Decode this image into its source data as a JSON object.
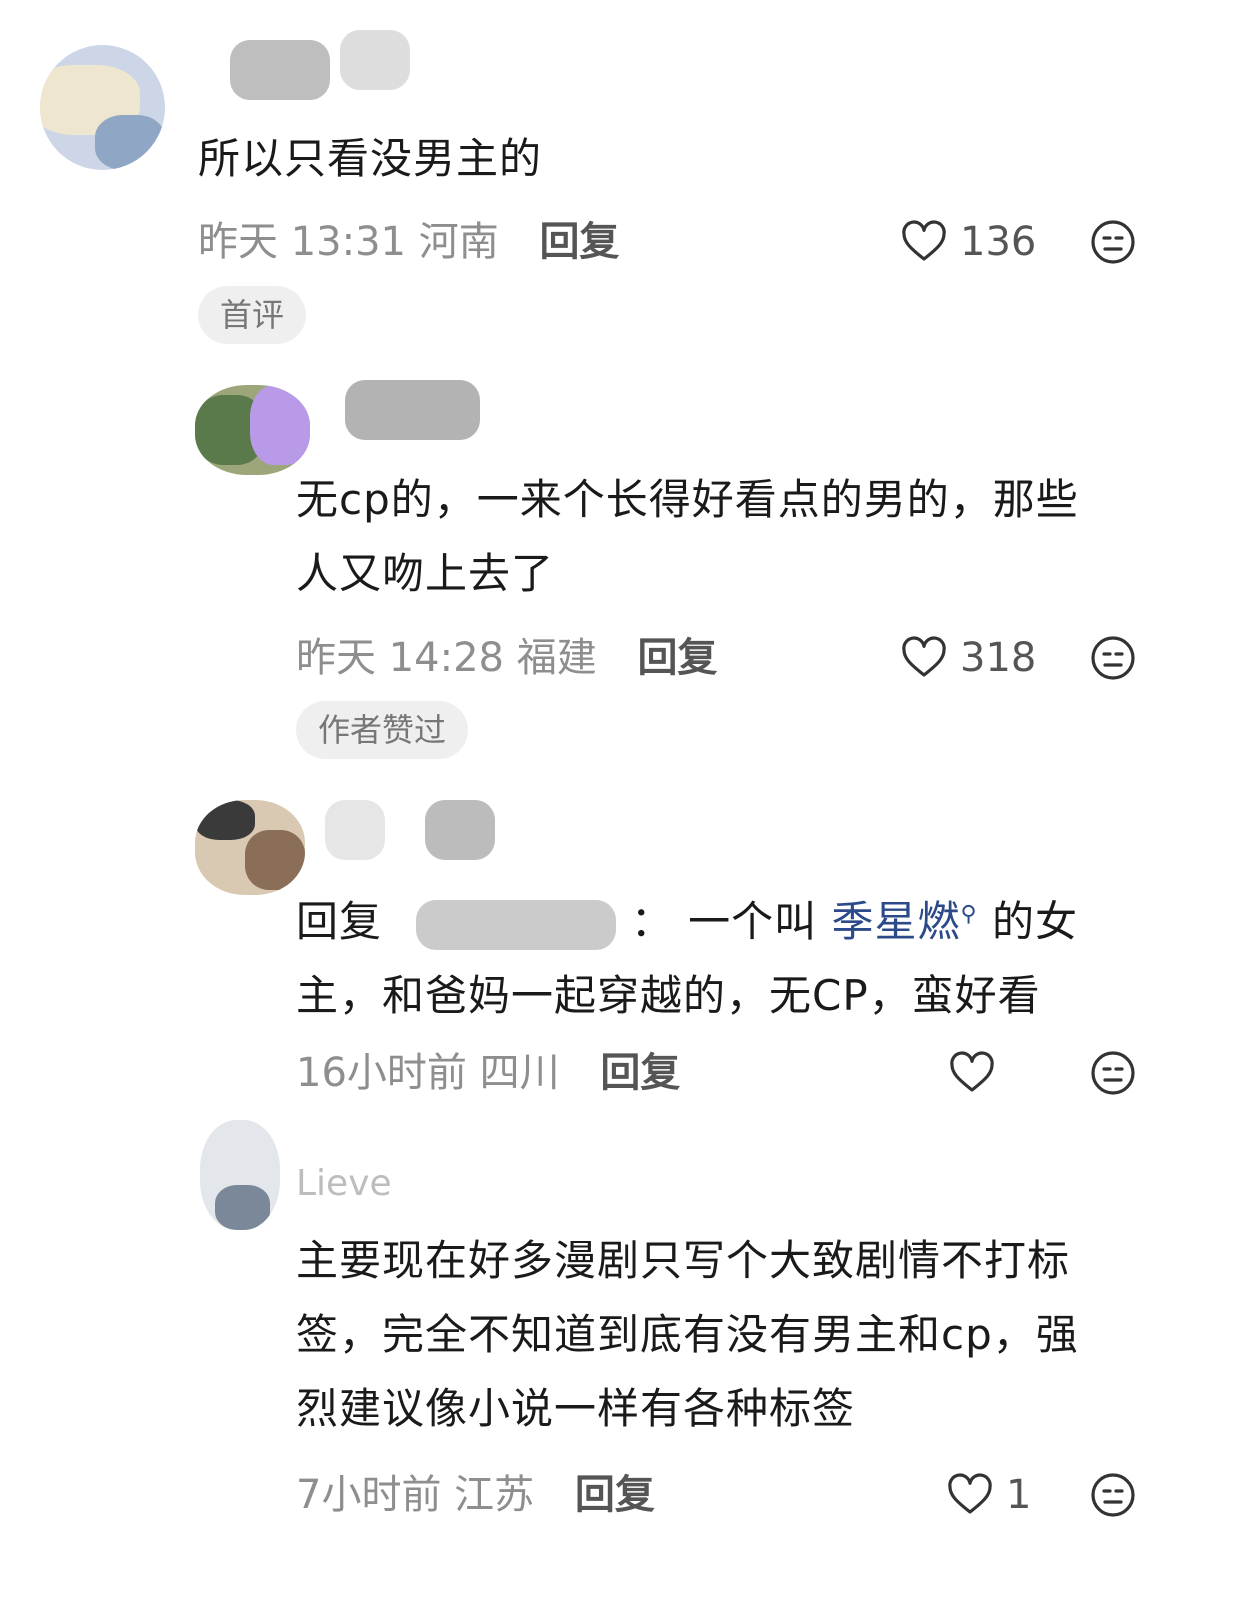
{
  "comments": [
    {
      "text": "所以只看没男主的",
      "time": "昨天 13:31",
      "location": "河南",
      "reply_label": "回复",
      "likes": "136",
      "tag": "首评"
    },
    {
      "text_line1": "无cp的，一来个长得好看点的男的，那些",
      "text_line2": "人又吻上去了",
      "time": "昨天 14:28",
      "location": "福建",
      "reply_label": "回复",
      "likes": "318",
      "tag": "作者赞过"
    },
    {
      "reply_prefix": "回复",
      "colon": "：",
      "text_a": "一个叫",
      "mention": "季星燃",
      "text_b": "的女",
      "text_line2": "主，和爸妈一起穿越的，无CP，蛮好看",
      "time": "16小时前",
      "location": "四川",
      "reply_label": "回复",
      "likes": ""
    },
    {
      "name_partial": "Lieve",
      "text_line1": "主要现在好多漫剧只写个大致剧情不打标",
      "text_line2": "签，完全不知道到底有没有男主和cp，强",
      "text_line3": "烈建议像小说一样有各种标签",
      "time": "7小时前",
      "location": "江苏",
      "reply_label": "回复",
      "likes": "1"
    }
  ],
  "icons": {
    "like": "heart-outline-icon",
    "dislike": "neutral-face-icon",
    "mention_search": "search-icon"
  },
  "colors": {
    "mention": "#2c4a8a",
    "meta": "#8e8e8e",
    "tag_bg": "#efefef"
  }
}
